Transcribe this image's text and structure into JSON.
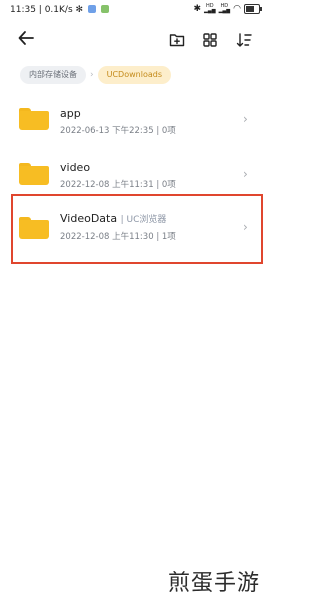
{
  "status_bar": {
    "time_speed": "11:35 | 0.1K/s",
    "signal1_label": "HD",
    "signal2_label": "HD"
  },
  "toolbar": {
    "back_icon": "back-arrow-icon",
    "new_folder_icon": "new-folder-icon",
    "view_toggle_icon": "grid-view-icon",
    "sort_icon": "sort-icon"
  },
  "breadcrumb": {
    "root": "内部存储设备",
    "current": "UCDownloads"
  },
  "files": [
    {
      "name": "app",
      "source": "",
      "date": "2022-06-13 下午22:35",
      "count": "0项"
    },
    {
      "name": "video",
      "source": "",
      "date": "2022-12-08 上午11:31",
      "count": "0项"
    },
    {
      "name": "VideoData",
      "source": "UC浏览器",
      "date": "2022-12-08 上午11:30",
      "count": "1项"
    }
  ],
  "colors": {
    "folder": "#f7bd23",
    "highlight_border": "#e0462e",
    "breadcrumb_active_bg": "#fdeecb",
    "breadcrumb_active_text": "#c48b1b"
  },
  "watermark": "煎蛋手游"
}
